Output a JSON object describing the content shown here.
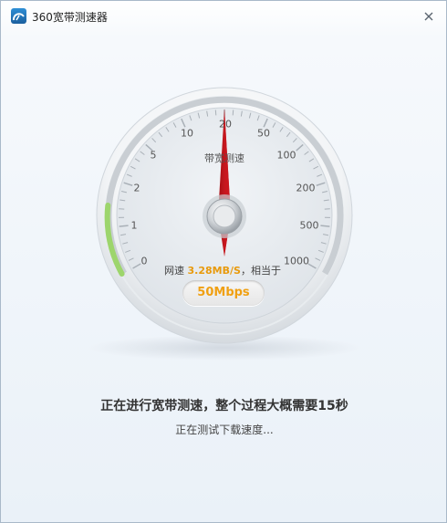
{
  "window": {
    "title": "360宽带测速器",
    "close_glyph": "×"
  },
  "gauge": {
    "label": "带宽测速",
    "scale_marks": [
      "0",
      "1",
      "2",
      "5",
      "10",
      "20",
      "50",
      "100",
      "200",
      "500",
      "1000"
    ],
    "current_mark_reading": "20",
    "speed_prefix": "网速",
    "speed_value": "3.28MB/S",
    "speed_suffix": "，相当于",
    "equivalent": "50Mbps",
    "accent_color": "#e89a0c",
    "needle_color": "#c8161d",
    "progress_color": "#9dd56c"
  },
  "status": {
    "title": "正在进行宽带测速，整个过程大概需要15秒",
    "subtitle": "正在测试下载速度..."
  }
}
